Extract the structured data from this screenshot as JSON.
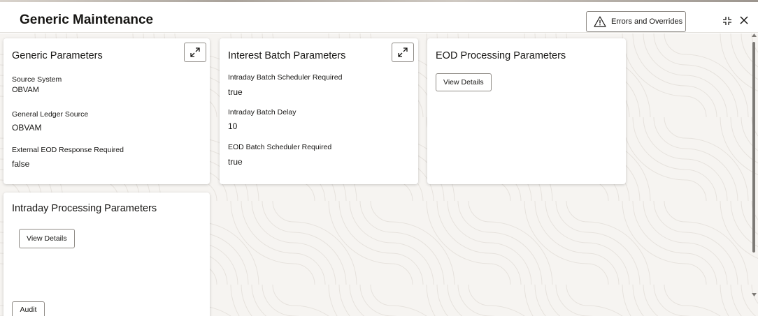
{
  "header": {
    "title": "Generic Maintenance",
    "errors_button_label": "Errors and Overrides"
  },
  "cards": {
    "generic": {
      "title": "Generic Parameters",
      "fields": [
        {
          "label": "Source System",
          "value": "OBVAM"
        },
        {
          "label": "General Ledger Source",
          "value": "OBVAM"
        },
        {
          "label": "External EOD Response Required",
          "value": "false"
        }
      ]
    },
    "interest": {
      "title": "Interest Batch Parameters",
      "fields": [
        {
          "label": "Intraday Batch Scheduler Required",
          "value": "true"
        },
        {
          "label": "Intraday Batch Delay",
          "value": "10"
        },
        {
          "label": "EOD Batch Scheduler Required",
          "value": "true"
        }
      ]
    },
    "eod": {
      "title": "EOD Processing Parameters",
      "view_label": "View Details"
    },
    "intraday": {
      "title": "Intraday Processing Parameters",
      "view_label": "View Details"
    }
  },
  "footer": {
    "audit_label": "Audit"
  },
  "icons": {
    "warning": "warning-icon",
    "minimize": "minimize-icon",
    "close": "close-icon",
    "expand": "expand-icon"
  },
  "colors": {
    "text": "#161513",
    "background": "#f6f4f1",
    "border": "#8f8b86"
  }
}
